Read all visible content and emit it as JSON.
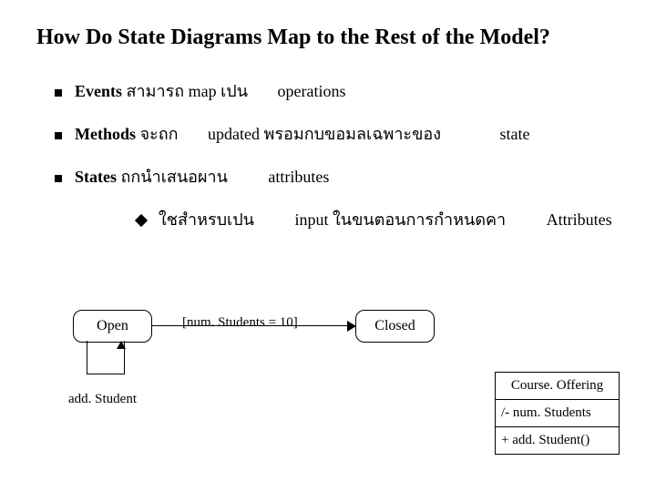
{
  "title": "How Do State Diagrams Map to the Rest of the Model?",
  "bullets": {
    "b1_strong": "Events",
    "b1_rest": "สามารถ map เปน",
    "b1_tail": "operations",
    "b2_strong": "Methods",
    "b2_rest": "จะถก",
    "b2_mid": "updated",
    "b2_tail": "พรอมกบขอมลเฉพาะของ",
    "b2_far": "state",
    "b3_strong": "States",
    "b3_rest": "ถกนำเสนอผาน",
    "b3_tail": "attributes"
  },
  "sub": {
    "lead": "ใชสำหรบเปน",
    "mid": "input",
    "tail": "ในขนตอนการกำหนดคา",
    "far": "Attributes"
  },
  "diagram": {
    "open": "Open",
    "closed": "Closed",
    "guard": "[num. Students = 10]",
    "event": "add. Student"
  },
  "class": {
    "name": "Course. Offering",
    "attr": "/- num. Students",
    "op": "+ add. Student()"
  }
}
